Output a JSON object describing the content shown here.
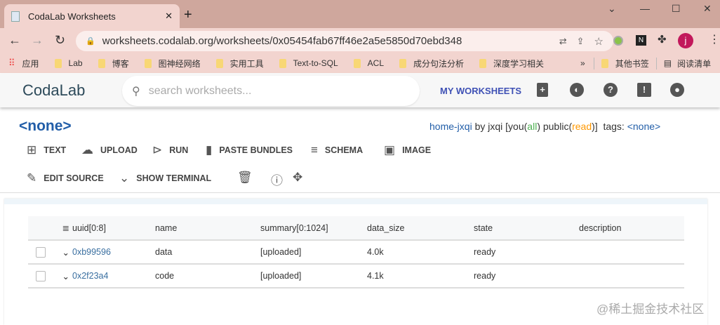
{
  "browser": {
    "tab_title": "CodaLab Worksheets",
    "url": "worksheets.codalab.org/worksheets/0x05454fab67ff46e2a5e5850d70ebd348",
    "bookmarks": [
      "应用",
      "Lab",
      "博客",
      "图神经网络",
      "实用工具",
      "Text-to-SQL",
      "ACL",
      "成分句法分析",
      "深度学习相关"
    ],
    "other_bookmarks": "其他书签",
    "reading_list": "阅读清单",
    "profile": "j"
  },
  "header": {
    "logo": "CodaLab",
    "search_placeholder": "search worksheets...",
    "my_worksheets": "MY WORKSHEETS"
  },
  "worksheet": {
    "title": "<none>",
    "name": "home-jxqi",
    "by": " by jxqi [you(",
    "you_perm": "all",
    "mid": ") public(",
    "public_perm": "read",
    "end": ")]  tags: ",
    "tags": "<none>"
  },
  "toolbar": {
    "text": "TEXT",
    "upload": "UPLOAD",
    "run": "RUN",
    "paste": "PASTE BUNDLES",
    "schema": "SCHEMA",
    "image": "IMAGE",
    "edit": "EDIT SOURCE",
    "terminal": "SHOW TERMINAL"
  },
  "table": {
    "headers": [
      "uuid[0:8]",
      "name",
      "summary[0:1024]",
      "data_size",
      "state",
      "description"
    ],
    "rows": [
      [
        "0xb99596",
        "data",
        "[uploaded]",
        "4.0k",
        "ready",
        ""
      ],
      [
        "0x2f23a4",
        "code",
        "[uploaded]",
        "4.1k",
        "ready",
        ""
      ]
    ]
  },
  "watermark": "@稀土掘金技术社区"
}
